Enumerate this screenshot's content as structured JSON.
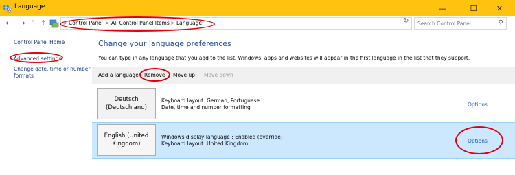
{
  "window": {
    "title": "Language",
    "icon": "language-icon",
    "minimize_glyph": "—",
    "maximize_glyph": "☐",
    "close_glyph": "✕"
  },
  "nav": {
    "back_glyph": "←",
    "forward_glyph": "→",
    "recent_glyph": "˅",
    "up_glyph": "↑"
  },
  "address": {
    "crumbs": [
      "Control Panel",
      "All Control Panel Items",
      "Language"
    ],
    "separator": ">",
    "dropdown_glyph": "˅",
    "refresh_glyph": "↻"
  },
  "search": {
    "placeholder": "Search Control Panel",
    "icon": "search-icon",
    "icon_glyph": "⚲"
  },
  "sidebar": {
    "items": [
      {
        "label": "Control Panel Home"
      },
      {
        "label": "Advanced settings"
      },
      {
        "label": "Change date, time or number formats"
      }
    ]
  },
  "main": {
    "title": "Change your language preferences",
    "description": "You can type in any language that you add to the list. Windows, apps and websites will appear in the first language in the list that they support."
  },
  "toolbar": {
    "add_label": "Add a language",
    "remove_label": "Remove",
    "move_up_label": "Move up",
    "move_down_label": "Move down"
  },
  "languages": [
    {
      "name": "Deutsch (Deutschland)",
      "details": [
        "Keyboard layout: German, Portuguese",
        "Date, time and number formatting"
      ],
      "options_label": "Options",
      "selected": false
    },
    {
      "name": "English (United Kingdom)",
      "details": [
        "Windows display language : Enabled (override)",
        "Keyboard layout: United Kingdom"
      ],
      "options_label": "Options",
      "selected": true
    }
  ],
  "colors": {
    "titlebar": "#FFC20E",
    "accent_link": "#1a3a8e",
    "title_blue": "#1e4f9c",
    "selection": "#cce8ff",
    "annotation_red": "#e3000b"
  }
}
